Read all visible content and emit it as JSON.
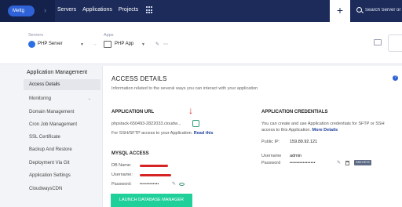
{
  "topbar": {
    "brand": "Mettg",
    "nav": [
      "Servers",
      "Applications",
      "Projects"
    ],
    "plus_label": "+",
    "search_placeholder": "Search Server or App"
  },
  "subheader": {
    "servers_label": "Servers",
    "server_name": "PHP Server",
    "apps_label": "Apps",
    "app_name": "PHP App"
  },
  "sidebar": {
    "title": "Application Management",
    "items": [
      {
        "label": "Access Details",
        "active": true
      },
      {
        "label": "Monitoring",
        "chevron": "⌄"
      },
      {
        "label": "Domain Management"
      },
      {
        "label": "Cron Job Management"
      },
      {
        "label": "SSL Certificate"
      },
      {
        "label": "Backup And Restore"
      },
      {
        "label": "Deployment Via Git"
      },
      {
        "label": "Application Settings"
      },
      {
        "label": "CloudwaysCDN"
      }
    ]
  },
  "access": {
    "title": "ACCESS DETAILS",
    "description": "Information related to the several ways you can interact with your application",
    "app_url_heading": "APPLICATION URL",
    "app_url": "phpstack-650493-2822033.cloudw...",
    "sftp_note": "For SSH/SFTP access to your Application.",
    "read_this": "Read this",
    "mysql_heading": "MYSQL ACCESS",
    "db_name_label": "DB Name:",
    "username_label": "Username:",
    "password_label": "Password:",
    "mysql_password": "••••••••••••",
    "launch_button": "LAUNCH DATABASE MANAGER",
    "cred_heading": "APPLICATION CREDENTIALS",
    "cred_desc_1": "You can create and use Application credentials for SFTP or SSH",
    "cred_desc_2": "access to this Application.",
    "more_details": "More Details",
    "public_ip_label": "Public IP:",
    "public_ip": "159.89.92.121",
    "cred_username_label": "Username",
    "cred_username": "admin",
    "cred_password_label": "Password",
    "cred_password": "••••••••••••••••",
    "ssh_keys": "SSH KEYS"
  }
}
